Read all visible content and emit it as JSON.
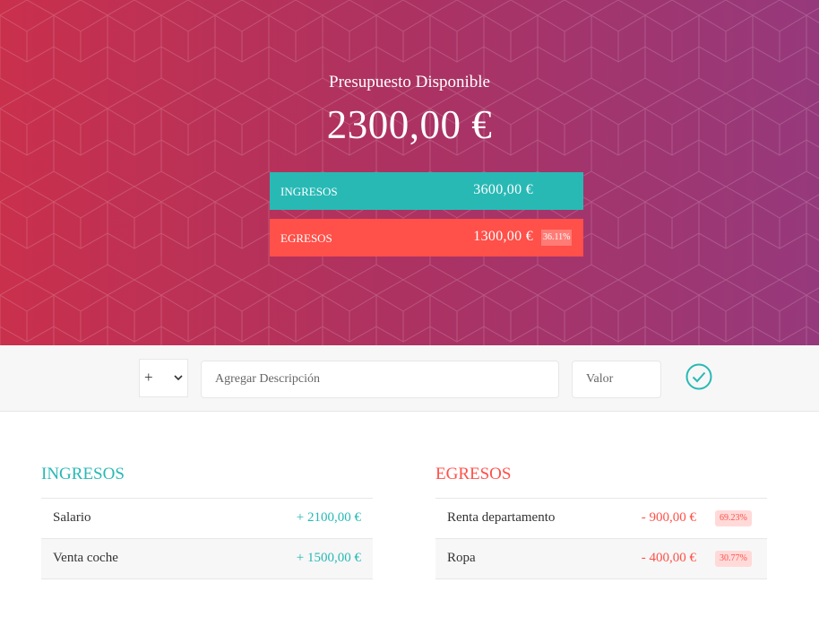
{
  "header": {
    "title": "Presupuesto Disponible",
    "value": "2300,00 €",
    "income": {
      "label": "INGRESOS",
      "value": "3600,00 €"
    },
    "expense": {
      "label": "EGRESOS",
      "value": "1300,00 €",
      "percentage": "36.11%"
    }
  },
  "add_form": {
    "type_selected": "+",
    "description_placeholder": "Agregar Descripción",
    "value_placeholder": "Valor"
  },
  "income_list": {
    "title": "INGRESOS",
    "items": [
      {
        "description": "Salario",
        "value": "+ 2100,00 €"
      },
      {
        "description": "Venta coche",
        "value": "+ 1500,00 €"
      }
    ]
  },
  "expense_list": {
    "title": "EGRESOS",
    "items": [
      {
        "description": "Renta departamento",
        "value": "- 900,00 €",
        "percentage": "69.23%"
      },
      {
        "description": "Ropa",
        "value": "- 400,00 €",
        "percentage": "30.77%"
      }
    ]
  },
  "colors": {
    "income": "#28b9b5",
    "expense": "#ff5049",
    "gradient_start": "#c9304c",
    "gradient_end": "#96397c"
  }
}
